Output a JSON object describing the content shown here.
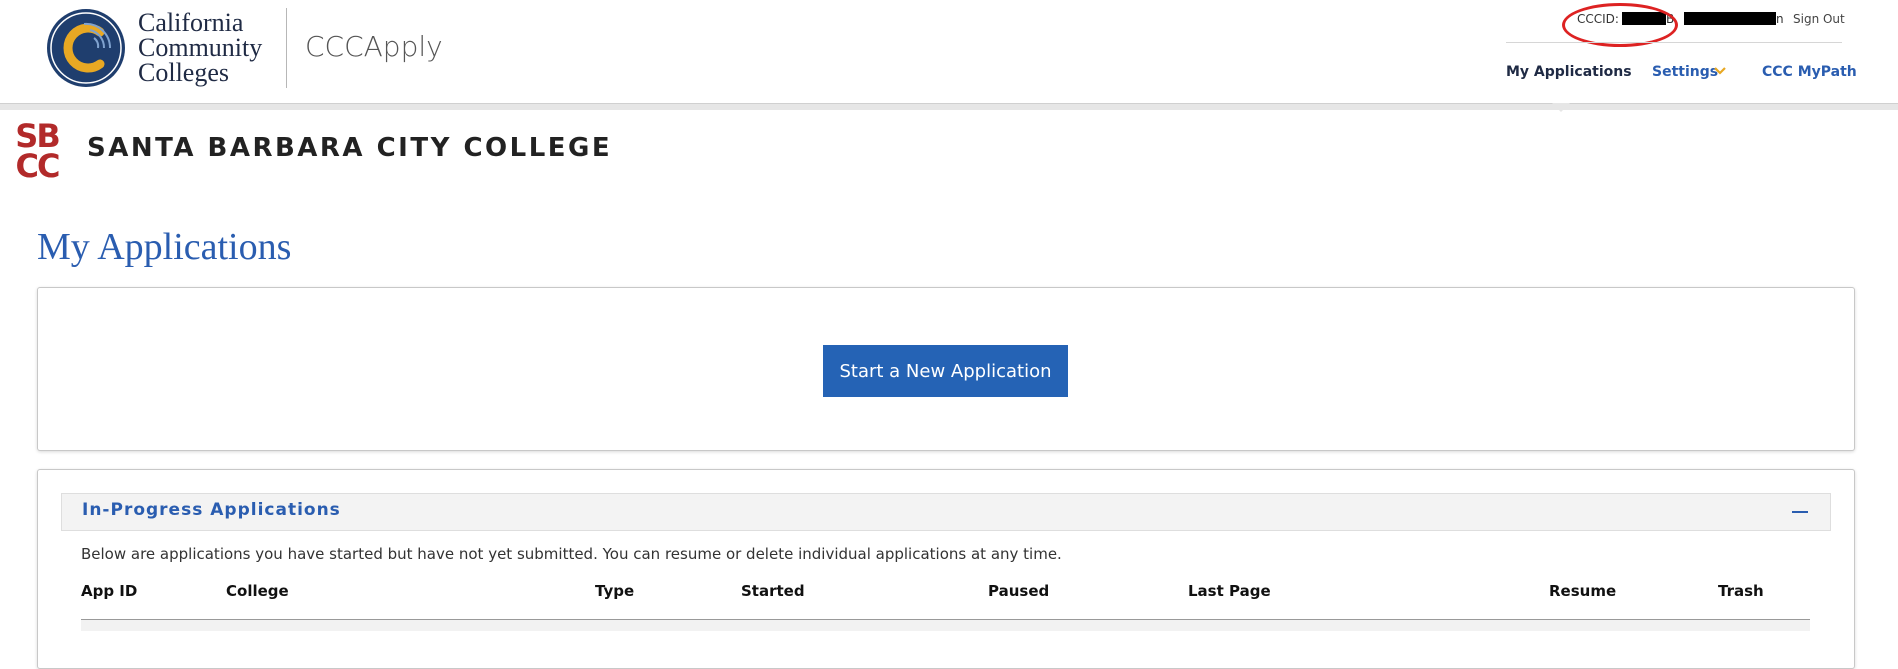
{
  "header": {
    "org_line1": "California",
    "org_line2": "Community",
    "org_line3": "Colleges",
    "app_name": "CCCApply",
    "cccid_label": "CCCID: E",
    "cccid_trail": "B",
    "name_trail": "n",
    "sign_out": "Sign Out",
    "nav": {
      "my_applications": "My Applications",
      "settings": "Settings",
      "mypath": "CCC MyPath"
    }
  },
  "college": {
    "logo_top": "SB",
    "logo_bottom": "CC",
    "name": "SANTA BARBARA CITY COLLEGE"
  },
  "page": {
    "title": "My Applications",
    "start_button": "Start a New Application"
  },
  "in_progress": {
    "title": "In-Progress Applications",
    "description": "Below are applications you have started but have not yet submitted. You can resume or delete individual applications at any time.",
    "columns": [
      "App ID",
      "College",
      "Type",
      "Started",
      "Paused",
      "Last Page",
      "Resume",
      "Trash"
    ]
  },
  "colors": {
    "brand_blue": "#2a5db0",
    "button_blue": "#2563b5",
    "sbcc_red": "#b22a2a",
    "seal_navy": "#1f3e6e",
    "seal_gold": "#e8a823",
    "annotation_red": "#dd2222"
  }
}
